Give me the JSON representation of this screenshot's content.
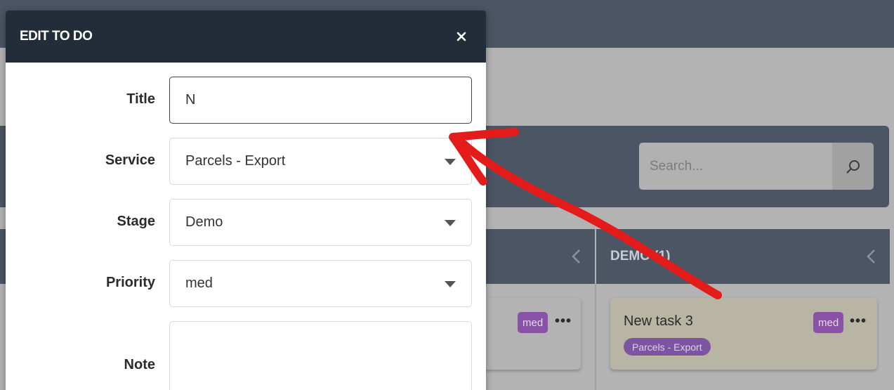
{
  "modal": {
    "title": "EDIT TO DO",
    "fields": {
      "title": {
        "label": "Title",
        "value": "N"
      },
      "service": {
        "label": "Service",
        "value": "Parcels - Export"
      },
      "stage": {
        "label": "Stage",
        "value": "Demo"
      },
      "priority": {
        "label": "Priority",
        "value": "med"
      },
      "note": {
        "label": "Note",
        "value": ""
      }
    }
  },
  "search": {
    "placeholder": "Search..."
  },
  "board": {
    "columns": [
      {
        "title": ""
      },
      {
        "title": "DEMO (1)"
      }
    ],
    "cards": [
      {
        "title": "",
        "priority": "med",
        "menu": "•••"
      },
      {
        "title": "New task 3",
        "priority": "med",
        "tag": "Parcels - Export",
        "menu": "•••"
      }
    ]
  },
  "colors": {
    "header": "#232d3a",
    "badge": "#8a52a6",
    "annotation": "#e41b1b"
  }
}
